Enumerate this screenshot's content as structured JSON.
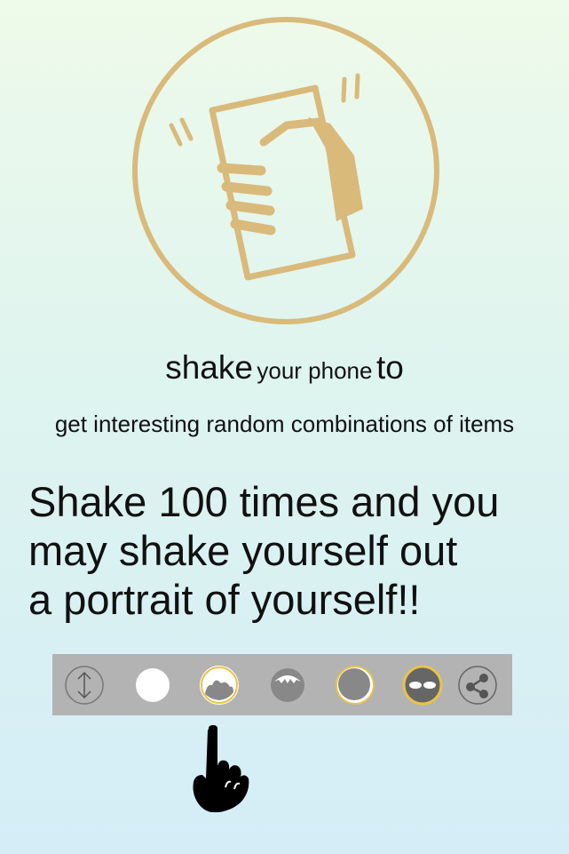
{
  "instructions": {
    "line1_a": "shake",
    "line1_b": "your phone",
    "line1_c": "to",
    "line2": "get interesting random combinations of items",
    "headline": [
      "Shake 100 times and you",
      "may shake yourself out",
      "a portrait of yourself!!"
    ]
  },
  "toolbar": {
    "items": [
      {
        "icon": "swap-vertical-icon"
      },
      {
        "icon": "face-base-icon"
      },
      {
        "icon": "hair-style-icon"
      },
      {
        "icon": "bangs-icon"
      },
      {
        "icon": "face-outline-icon"
      },
      {
        "icon": "eyes-icon"
      },
      {
        "icon": "share-icon"
      }
    ]
  },
  "colors": {
    "accent": "#d9ba7a",
    "toolbar_bg": "#b3b3b3",
    "icon_gray": "#888888",
    "ring_gold": "#e8c34a"
  }
}
